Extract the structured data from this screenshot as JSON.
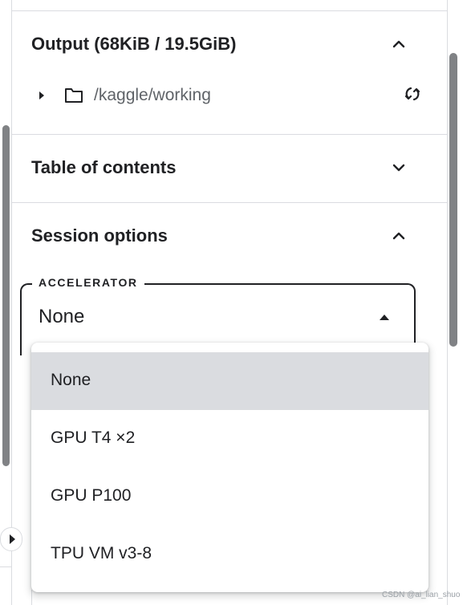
{
  "output_section": {
    "title": "Output (68KiB / 19.5GiB)",
    "expanded": true,
    "path": "/kaggle/working",
    "icons": [
      "expand-arrow-icon",
      "folder-icon",
      "refresh-icon"
    ]
  },
  "toc_section": {
    "title": "Table of contents",
    "expanded": false
  },
  "session_section": {
    "title": "Session options",
    "expanded": true,
    "accelerator": {
      "label": "ACCELERATOR",
      "value": "None",
      "options": [
        "None",
        "GPU T4 ×2",
        "GPU P100",
        "TPU VM v3-8"
      ],
      "selected_index": 0
    }
  },
  "watermark": "CSDN @ai_lian_shuo",
  "colors": {
    "text": "#202124",
    "muted": "#5f6368",
    "divider": "#dadce0",
    "selected_bg": "#dadce0",
    "scrollbar": "#808285"
  }
}
